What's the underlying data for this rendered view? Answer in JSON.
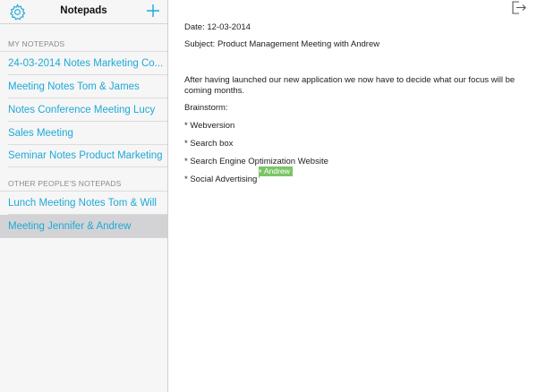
{
  "sidebar": {
    "title": "Notepads",
    "my_notepads_label": "MY NOTEPADS",
    "other_notepads_label": "OTHER PEOPLE'S NOTEPADS",
    "my_notepads": [
      {
        "label": "24-03-2014 Notes Marketing Co..."
      },
      {
        "label": "Meeting Notes Tom & James"
      },
      {
        "label": "Notes Conference Meeting Lucy"
      },
      {
        "label": "Sales Meeting"
      },
      {
        "label": "Seminar Notes Product Marketing"
      }
    ],
    "other_notepads": [
      {
        "label": "Lunch Meeting Notes Tom & Will"
      },
      {
        "label": "Meeting Jennifer & Andrew",
        "selected": true
      }
    ]
  },
  "note": {
    "date_line": "Date: 12-03-2014",
    "subject_line": "Subject: Product Management Meeting with Andrew",
    "paragraph": "After having launched our new application we now have to decide what our focus will be coming months.",
    "brainstorm": "Brainstorm:",
    "bullets": [
      "* Webversion",
      "* Search box",
      "* Search Engine Optimization Website",
      "* Social Advertising"
    ]
  },
  "collaborator_cursor": {
    "name": "Andrew",
    "color": "#7bc567"
  },
  "colors": {
    "accent": "#1ea9d6",
    "selected_row": "#d3d3d6"
  },
  "icons": {
    "settings": "gear-icon",
    "add": "plus-icon",
    "exit": "exit-icon"
  }
}
